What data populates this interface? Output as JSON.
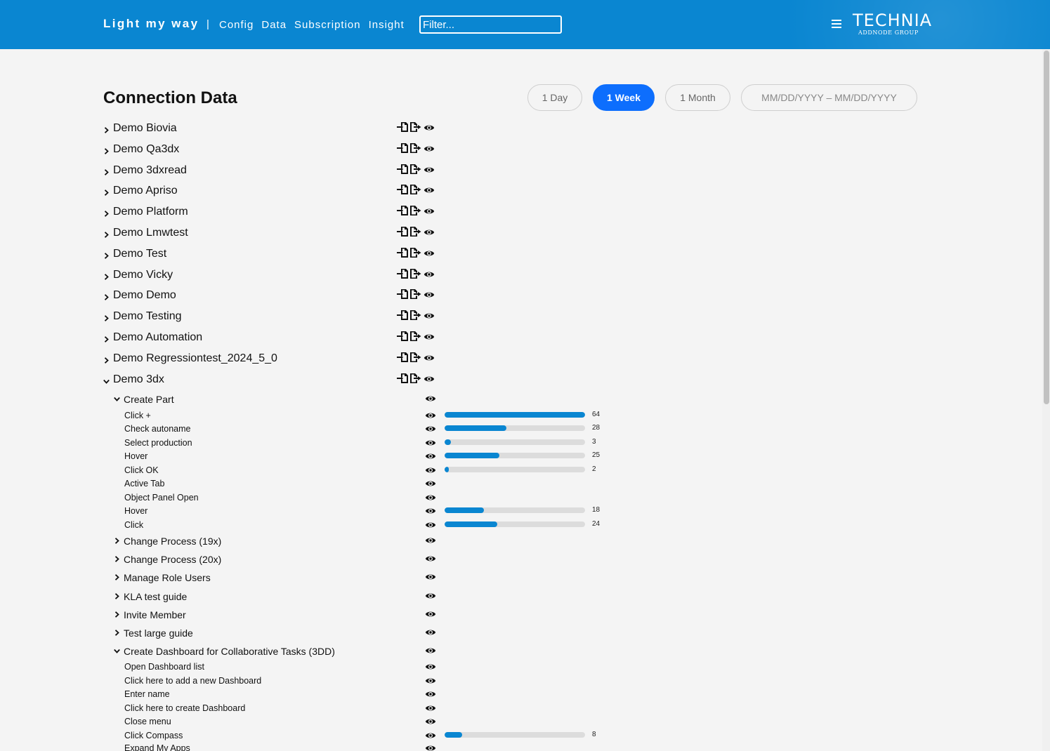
{
  "header": {
    "brand": "Light my way",
    "separator": "|",
    "nav": [
      "Config",
      "Data",
      "Subscription",
      "Insight"
    ],
    "filter_placeholder": "Filter...",
    "logo_name": "TECHNIA",
    "logo_sub": "ADDNODE GROUP"
  },
  "page": {
    "title": "Connection Data",
    "ranges": [
      {
        "label": "1 Day",
        "active": false
      },
      {
        "label": "1 Week",
        "active": true
      },
      {
        "label": "1 Month",
        "active": false
      }
    ],
    "date_range_placeholder": "MM/DD/YYYY – MM/DD/YYYY"
  },
  "icons": {
    "tenant_actions": [
      "import-icon",
      "export-icon",
      "eye-icon"
    ],
    "guide_action": "eye-icon"
  },
  "colors": {
    "header": "#0a86d1",
    "active_range": "#0d6efd",
    "bar_fill": "#0a86d1",
    "bar_track": "#dcdcdc"
  },
  "bar_max": 64,
  "tree": [
    {
      "level": 0,
      "label": "Demo Biovia",
      "expanded": false
    },
    {
      "level": 0,
      "label": "Demo Qa3dx",
      "expanded": false
    },
    {
      "level": 0,
      "label": "Demo 3dxread",
      "expanded": false
    },
    {
      "level": 0,
      "label": "Demo Apriso",
      "expanded": false
    },
    {
      "level": 0,
      "label": "Demo Platform",
      "expanded": false
    },
    {
      "level": 0,
      "label": "Demo Lmwtest",
      "expanded": false
    },
    {
      "level": 0,
      "label": "Demo Test",
      "expanded": false
    },
    {
      "level": 0,
      "label": "Demo Vicky",
      "expanded": false
    },
    {
      "level": 0,
      "label": "Demo Demo",
      "expanded": false
    },
    {
      "level": 0,
      "label": "Demo Testing",
      "expanded": false
    },
    {
      "level": 0,
      "label": "Demo Automation",
      "expanded": false
    },
    {
      "level": 0,
      "label": "Demo Regressiontest_2024_5_0",
      "expanded": false
    },
    {
      "level": 0,
      "label": "Demo 3dx",
      "expanded": true
    },
    {
      "level": 1,
      "label": "Create Part",
      "expanded": true
    },
    {
      "level": 2,
      "label": "Click +",
      "count": 64
    },
    {
      "level": 2,
      "label": "Check autoname",
      "count": 28
    },
    {
      "level": 2,
      "label": "Select production",
      "count": 3
    },
    {
      "level": 2,
      "label": "Hover",
      "count": 25
    },
    {
      "level": 2,
      "label": "Click OK",
      "count": 2
    },
    {
      "level": 2,
      "label": "Active Tab"
    },
    {
      "level": 2,
      "label": "Object Panel Open"
    },
    {
      "level": 2,
      "label": "Hover",
      "count": 18
    },
    {
      "level": 2,
      "label": "Click",
      "count": 24
    },
    {
      "level": 1,
      "label": "Change Process (19x)",
      "expanded": false
    },
    {
      "level": 1,
      "label": "Change Process (20x)",
      "expanded": false
    },
    {
      "level": 1,
      "label": "Manage Role Users",
      "expanded": false
    },
    {
      "level": 1,
      "label": "KLA test guide",
      "expanded": false
    },
    {
      "level": 1,
      "label": "Invite Member",
      "expanded": false
    },
    {
      "level": 1,
      "label": "Test large guide",
      "expanded": false
    },
    {
      "level": 1,
      "label": "Create Dashboard for Collaborative Tasks (3DD)",
      "expanded": true
    },
    {
      "level": 2,
      "label": "Open Dashboard list"
    },
    {
      "level": 2,
      "label": "Click here to add a new Dashboard"
    },
    {
      "level": 2,
      "label": "Enter name"
    },
    {
      "level": 2,
      "label": "Click here to create Dashboard"
    },
    {
      "level": 2,
      "label": "Close menu"
    },
    {
      "level": 2,
      "label": "Click Compass",
      "count": 8
    },
    {
      "level": 2,
      "label": "Expand My Apps"
    }
  ]
}
